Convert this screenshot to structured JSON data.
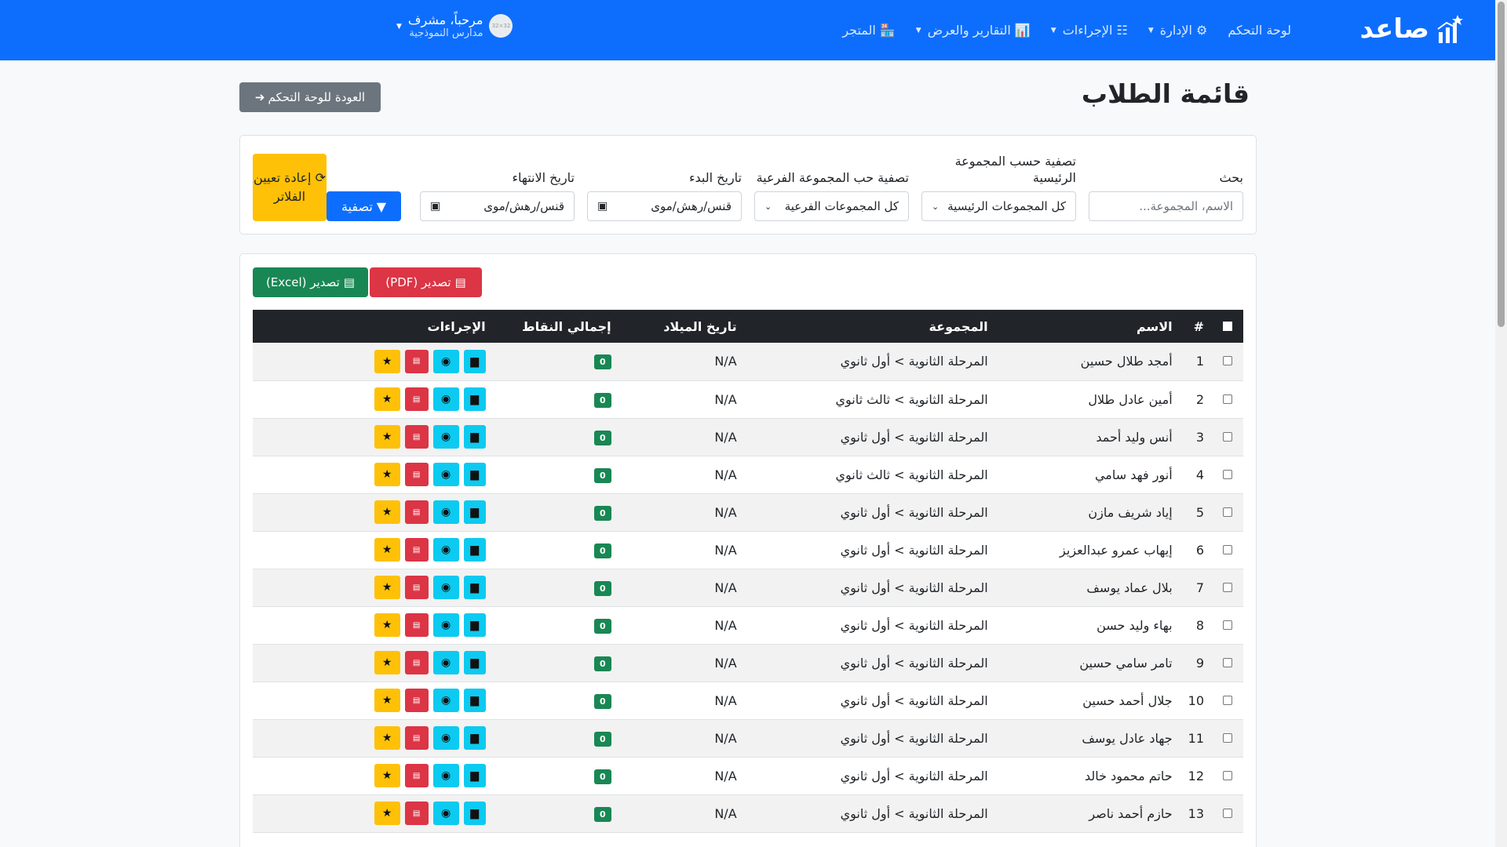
{
  "navbar": {
    "brand": "صاعد",
    "items": [
      {
        "label": "لوحة التحكم",
        "icon": "",
        "has_caret": false
      },
      {
        "label": "الإدارة",
        "icon": "⚙",
        "has_caret": true
      },
      {
        "label": "الإجراءات",
        "icon": "☷",
        "has_caret": true
      },
      {
        "label": "التقارير والعرض",
        "icon": "📊",
        "has_caret": true
      },
      {
        "label": "المتجر",
        "icon": "🏪",
        "has_caret": false
      }
    ],
    "user": {
      "greeting": "مرحباً، مشرف",
      "school": "مدارس النموذجية",
      "avatar_text": "32×32"
    }
  },
  "page": {
    "title": "قائمة الطلاب",
    "back_label": "العودة للوحة التحكم"
  },
  "filters": {
    "search": {
      "label": "بحث",
      "placeholder": "الاسم، المجموعة..."
    },
    "main_group": {
      "label": "تصفية حسب المجموعة الرئيسية",
      "value": "كل المجموعات الرئيسية"
    },
    "sub_group": {
      "label": "تصفية حب المجموعة الفرعية",
      "value": "كل المجموعات الفرعية"
    },
    "start_date": {
      "label": "تاريخ البدء",
      "value": "ﻗﻨﺲ/ﺭﻫﺶ/ﻣﻮﻯ"
    },
    "end_date": {
      "label": "تاريخ الانتهاء",
      "value": "ﻗﻨﺲ/ﺭﻫﺶ/ﻣﻮﻯ"
    },
    "filter_label": "تصفية",
    "reset_label": "إعادة تعيين الفلاتر"
  },
  "export": {
    "pdf_label": "تصدير (PDF)",
    "excel_label": "تصدير (Excel)"
  },
  "table": {
    "headers": {
      "num": "#",
      "name": "الاسم",
      "group": "المجموعة",
      "birth": "تاريخ الميلاد",
      "points": "إجمالي النقاط",
      "actions": "الإجراءات"
    },
    "rows": [
      {
        "num": "1",
        "name": "أمجد طلال حسين",
        "group": "المرحلة الثانوية > أول ثانوي",
        "birth": "N/A",
        "points": "0"
      },
      {
        "num": "2",
        "name": "أمين عادل طلال",
        "group": "المرحلة الثانوية > ثالث ثانوي",
        "birth": "N/A",
        "points": "0"
      },
      {
        "num": "3",
        "name": "أنس وليد أحمد",
        "group": "المرحلة الثانوية > أول ثانوي",
        "birth": "N/A",
        "points": "0"
      },
      {
        "num": "4",
        "name": "أنور فهد سامي",
        "group": "المرحلة الثانوية > ثالث ثانوي",
        "birth": "N/A",
        "points": "0"
      },
      {
        "num": "5",
        "name": "إياد شريف مازن",
        "group": "المرحلة الثانوية > أول ثانوي",
        "birth": "N/A",
        "points": "0"
      },
      {
        "num": "6",
        "name": "إيهاب عمرو عبدالعزيز",
        "group": "المرحلة الثانوية > أول ثانوي",
        "birth": "N/A",
        "points": "0"
      },
      {
        "num": "7",
        "name": "بلال عماد يوسف",
        "group": "المرحلة الثانوية > أول ثانوي",
        "birth": "N/A",
        "points": "0"
      },
      {
        "num": "8",
        "name": "بهاء وليد حسن",
        "group": "المرحلة الثانوية > أول ثانوي",
        "birth": "N/A",
        "points": "0"
      },
      {
        "num": "9",
        "name": "تامر سامي حسين",
        "group": "المرحلة الثانوية > أول ثانوي",
        "birth": "N/A",
        "points": "0"
      },
      {
        "num": "10",
        "name": "جلال أحمد حسين",
        "group": "المرحلة الثانوية > أول ثانوي",
        "birth": "N/A",
        "points": "0"
      },
      {
        "num": "11",
        "name": "جهاد عادل يوسف",
        "group": "المرحلة الثانوية > أول ثانوي",
        "birth": "N/A",
        "points": "0"
      },
      {
        "num": "12",
        "name": "حاتم محمود خالد",
        "group": "المرحلة الثانوية > أول ثانوي",
        "birth": "N/A",
        "points": "0"
      },
      {
        "num": "13",
        "name": "حازم أحمد ناصر",
        "group": "المرحلة الثانوية > أول ثانوي",
        "birth": "N/A",
        "points": "0"
      }
    ]
  },
  "colors": {
    "primary": "#0d6efd",
    "success": "#198754",
    "danger": "#dc3545",
    "warning": "#ffc107",
    "info": "#0dcaf0",
    "dark": "#212529",
    "secondary": "#6c757d"
  }
}
